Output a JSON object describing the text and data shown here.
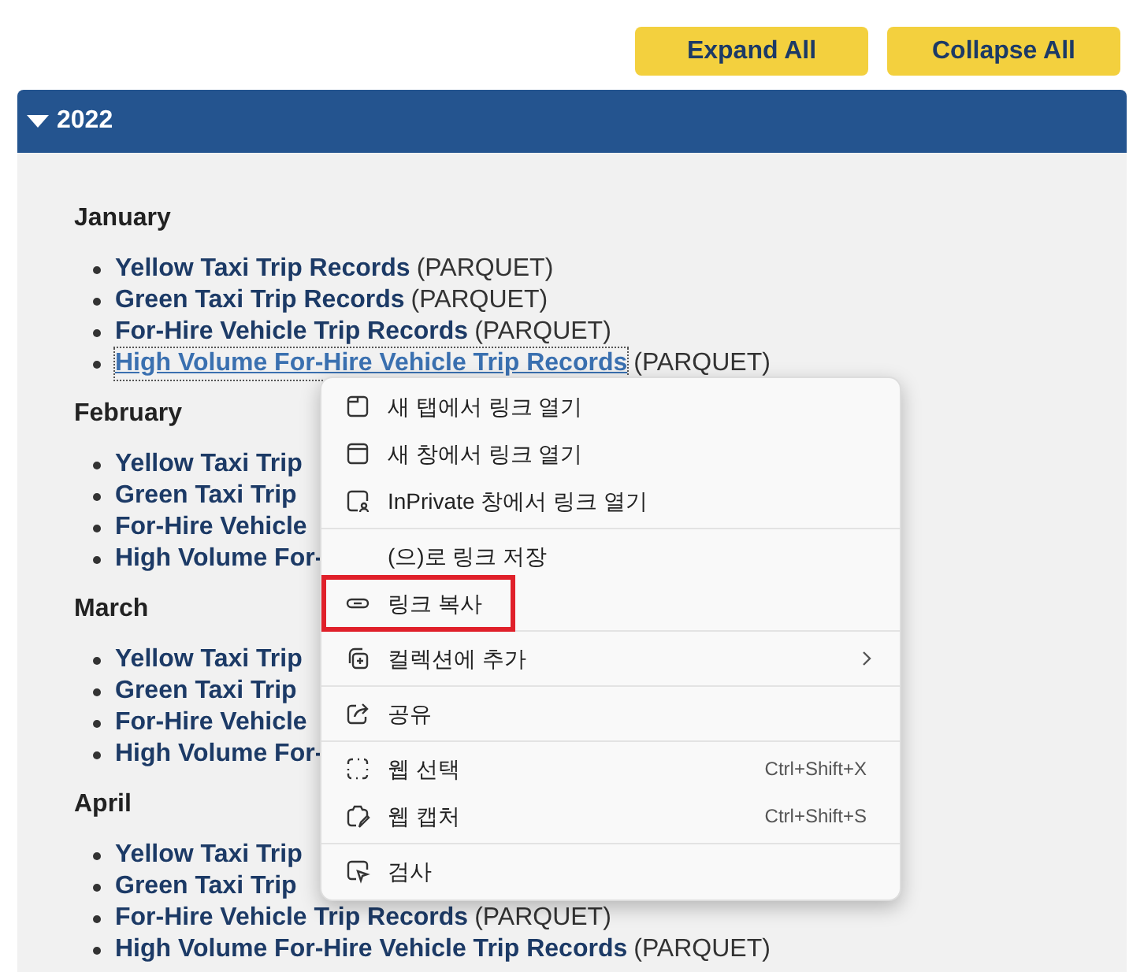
{
  "buttons": [
    {
      "label": "Expand All"
    },
    {
      "label": "Collapse All"
    }
  ],
  "section": {
    "title": "2022",
    "expanded": true,
    "months": [
      {
        "name": "January",
        "items": [
          {
            "name": "Yellow Taxi Trip Records",
            "format": "(PARQUET)",
            "focused": false
          },
          {
            "name": "Green Taxi Trip Records",
            "format": "(PARQUET)",
            "focused": false
          },
          {
            "name": "For-Hire Vehicle Trip Records",
            "format": "(PARQUET)",
            "focused": false
          },
          {
            "name": "High Volume For-Hire Vehicle Trip Records",
            "format": "(PARQUET)",
            "focused": true
          }
        ]
      },
      {
        "name": "February",
        "items": [
          {
            "name": "Yellow Taxi Trip",
            "focused": false
          },
          {
            "name": "Green Taxi Trip",
            "focused": false
          },
          {
            "name": "For-Hire Vehicle",
            "focused": false
          },
          {
            "name": "High Volume For-",
            "focused": false
          }
        ]
      },
      {
        "name": "March",
        "items": [
          {
            "name": "Yellow Taxi Trip",
            "focused": false
          },
          {
            "name": "Green Taxi Trip",
            "focused": false
          },
          {
            "name": "For-Hire Vehicle",
            "focused": false
          },
          {
            "name": "High Volume For-",
            "focused": false
          }
        ]
      },
      {
        "name": "April",
        "items": [
          {
            "name": "Yellow Taxi Trip",
            "focused": false
          },
          {
            "name": "Green Taxi Trip",
            "focused": false
          },
          {
            "name": "For-Hire Vehicle Trip Records",
            "format": "(PARQUET)",
            "focused": false
          },
          {
            "name": "High Volume For-Hire Vehicle Trip Records",
            "format": "(PARQUET)",
            "focused": false
          }
        ]
      }
    ]
  },
  "context_menu": {
    "items": [
      {
        "kind": "item",
        "label": "새 탭에서 링크 열기",
        "highlighted": false
      },
      {
        "kind": "item",
        "label": "새 창에서 링크 열기",
        "highlighted": false
      },
      {
        "kind": "item",
        "label": "InPrivate 창에서 링크 열기",
        "highlighted": false
      },
      {
        "kind": "separator"
      },
      {
        "kind": "item",
        "label": "(으)로 링크 저장",
        "highlighted": false
      },
      {
        "kind": "item",
        "label": "링크 복사",
        "highlighted": true
      },
      {
        "kind": "separator"
      },
      {
        "kind": "item",
        "label": "컬렉션에 추가",
        "highlighted": false,
        "submenu": true
      },
      {
        "kind": "separator"
      },
      {
        "kind": "item",
        "label": "공유",
        "highlighted": false
      },
      {
        "kind": "separator"
      },
      {
        "kind": "item",
        "label": "웹 선택",
        "shortcut": "Ctrl+Shift+X",
        "highlighted": false
      },
      {
        "kind": "item",
        "label": "웹 캡처",
        "shortcut": "Ctrl+Shift+S",
        "highlighted": false
      },
      {
        "kind": "separator"
      },
      {
        "kind": "item",
        "label": "검사",
        "highlighted": false
      }
    ]
  }
}
